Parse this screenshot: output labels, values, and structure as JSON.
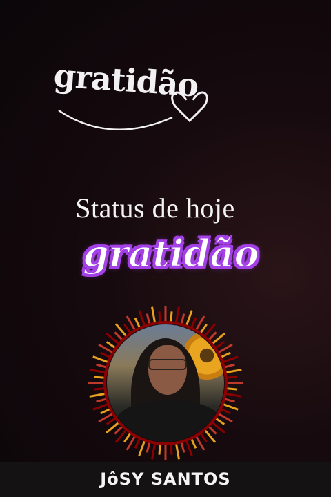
{
  "logo": {
    "text": "gratidão"
  },
  "status": {
    "heading": "Status de hoje",
    "sticker": "gratidão"
  },
  "profile": {
    "name": "JôSY SANTOS",
    "frame_colors": [
      "#c0392b",
      "#e8a21e",
      "#8b0000"
    ]
  },
  "colors": {
    "background": "#0b0609",
    "sticker_outline": "#a340e6",
    "text": "#f4f4f4"
  }
}
